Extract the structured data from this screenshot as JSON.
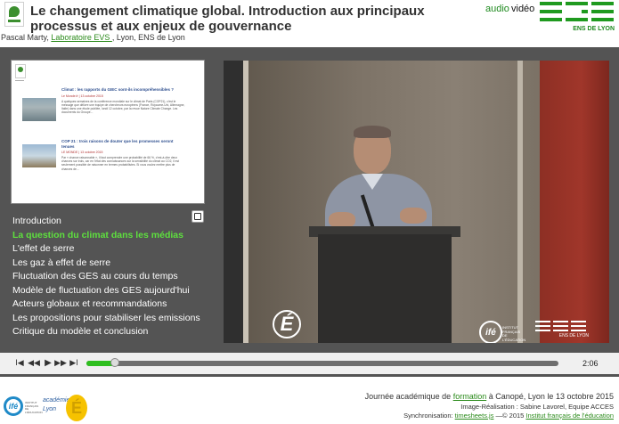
{
  "header": {
    "title": "Le changement climatique global. Introduction aux principaux processus et aux enjeux de gouvernance",
    "author": "Pascal Marty, ",
    "lab_link": "Laboratoire EVS ",
    "location": ", Lyon, ENS de Lyon",
    "mode_audio": "audio",
    "mode_video": "vidéo",
    "ens_tag": "ENS DE LYON"
  },
  "slide": {
    "articles": [
      {
        "title": "Climat : les rapports du GIEC sont-ils incompréhensibles ?",
        "date": "Le Monde.fr | 13 octobre 2015",
        "body": "A quelques semaines de la conférence mondiale sur le climat de Paris (COP21), c'est le message que délivre une équipe de chercheurs européens (France, Royaume-Uni, Allemagne, Italie) dans une étude publiée, lundi 12 octobre, par la revue Nature Climate Change. Les documents du Groupe..."
      },
      {
        "title": "COP 21 : trois raisons de douter que les promesses seront tenues",
        "date": "LE MONDE | 13 octobre 2015",
        "body": "Par « chance raisonnable », il faut comprendre une probabilité de 66 %, c'est-à-dire deux chances sur trois, car en l'état des connaissances sur la sensibilité du climat au CO2, il est seulement possible de raisonner en termes probabilistes. Si vous voulez mettre plus de chances de..."
      }
    ]
  },
  "chapters": [
    "Introduction",
    "La question du climat dans les médias",
    "L'effet de serre",
    "Les gaz à effet de serre",
    "Fluctuation des GES au cours du temps",
    "Modèle de fluctuation des GES aujourd'hui",
    "Acteurs globaux et recommandations",
    "Les propositions pour stabiliser les emissions",
    "Critique du modèle et conclusion"
  ],
  "active_chapter": 1,
  "video": {
    "overlay_e": "É",
    "overlay_ife": "ifé",
    "overlay_ife_text": "INSTITUT FRANÇAIS DE L'ÉDUCATION",
    "overlay_ens_tag": "ENS DE LYON"
  },
  "player": {
    "icons": [
      "skip-start-icon",
      "rewind-icon",
      "play-icon",
      "fast-forward-icon",
      "skip-end-icon"
    ],
    "glyphs": {
      "start": "I◀",
      "rewind": "◀◀",
      "play": "▶",
      "forward": "▶▶",
      "end": "▶I"
    },
    "progress": 0.06,
    "time": "2:06"
  },
  "footer": {
    "logo_ife": "ifé",
    "logo_ife_text": "INSTITUT FRANÇAIS DE L'ÉDUCATION",
    "logo_acad": "académie",
    "logo_city": "Lyon",
    "logo_e": "É",
    "line1_a": "Journée académique de ",
    "line1_link": "formation",
    "line1_b": " à Canopé, Lyon le 13 octobre 2015",
    "line2": "Image-Réalisation : Sabine Lavorel, Equipe ACCES",
    "line3_a": "Synchronisation: ",
    "line3_link1": "timesheets.js",
    "line3_b": " —© 2015 ",
    "line3_link2": "Institut français de l'éducation"
  },
  "colors": {
    "accent_green": "#2fbf1f",
    "active_chapter": "#5ee03e",
    "panel_bg": "#545454",
    "link": "#2a8a1a"
  }
}
